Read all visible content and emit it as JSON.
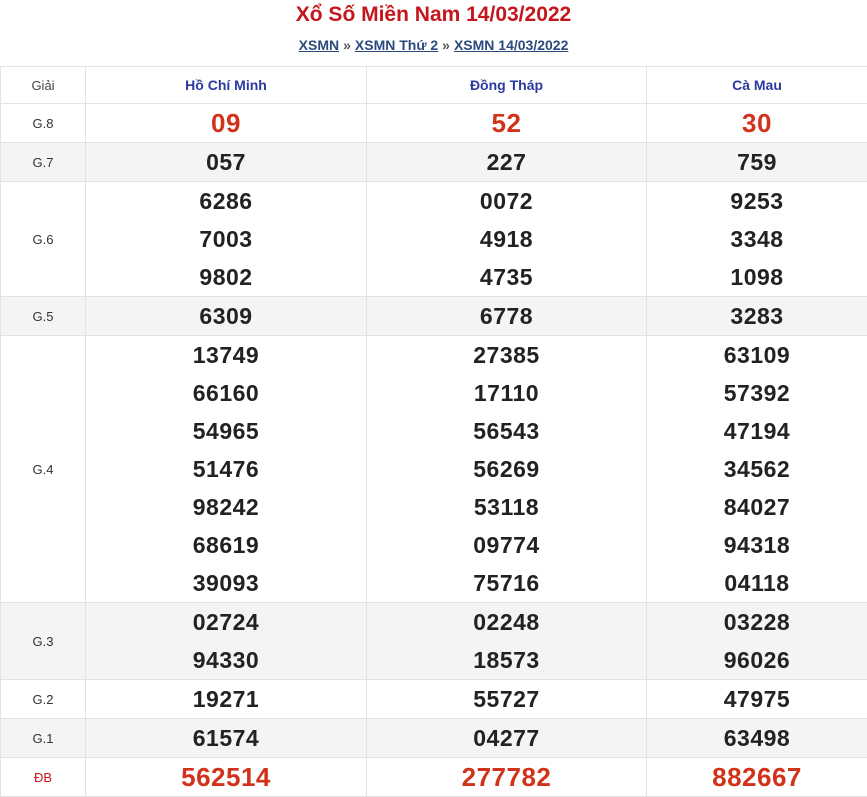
{
  "header": {
    "title": "Xổ Số Miền Nam 14/03/2022",
    "breadcrumb": [
      "XSMN",
      "XSMN Thứ 2",
      "XSMN 14/03/2022"
    ],
    "separator": "»"
  },
  "table": {
    "col_giai": "Giải",
    "provinces": [
      "Hồ Chí Minh",
      "Đồng Tháp",
      "Cà Mau"
    ],
    "rows": [
      {
        "label": "G.8",
        "values": [
          [
            "09"
          ],
          [
            "52"
          ],
          [
            "30"
          ]
        ]
      },
      {
        "label": "G.7",
        "values": [
          [
            "057"
          ],
          [
            "227"
          ],
          [
            "759"
          ]
        ]
      },
      {
        "label": "G.6",
        "values": [
          [
            "6286",
            "7003",
            "9802"
          ],
          [
            "0072",
            "4918",
            "4735"
          ],
          [
            "9253",
            "3348",
            "1098"
          ]
        ]
      },
      {
        "label": "G.5",
        "values": [
          [
            "6309"
          ],
          [
            "6778"
          ],
          [
            "3283"
          ]
        ]
      },
      {
        "label": "G.4",
        "values": [
          [
            "13749",
            "66160",
            "54965",
            "51476",
            "98242",
            "68619",
            "39093"
          ],
          [
            "27385",
            "17110",
            "56543",
            "56269",
            "53118",
            "09774",
            "75716"
          ],
          [
            "63109",
            "57392",
            "47194",
            "34562",
            "84027",
            "94318",
            "04118"
          ]
        ]
      },
      {
        "label": "G.3",
        "values": [
          [
            "02724",
            "94330"
          ],
          [
            "02248",
            "18573"
          ],
          [
            "03228",
            "96026"
          ]
        ]
      },
      {
        "label": "G.2",
        "values": [
          [
            "19271"
          ],
          [
            "55727"
          ],
          [
            "47975"
          ]
        ]
      },
      {
        "label": "G.1",
        "values": [
          [
            "61574"
          ],
          [
            "04277"
          ],
          [
            "63498"
          ]
        ]
      },
      {
        "label": "ĐB",
        "values": [
          [
            "562514"
          ],
          [
            "277782"
          ],
          [
            "882667"
          ]
        ]
      }
    ]
  },
  "colors": {
    "accent_red": "#c4161c",
    "number_red": "#d3321a",
    "header_blue": "#2a3a9e",
    "link_blue": "#2a4a7f",
    "alt_row": "#f4f4f4"
  }
}
